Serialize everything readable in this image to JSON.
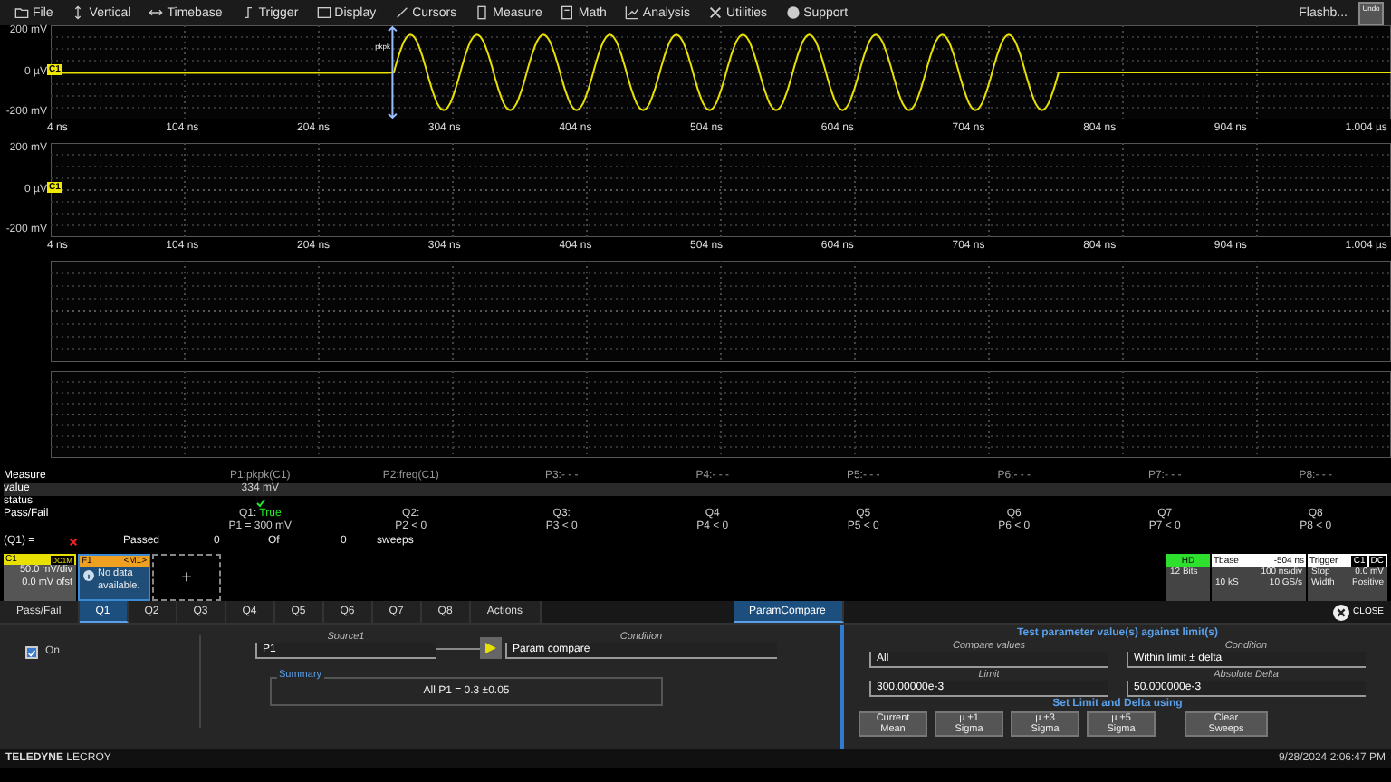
{
  "menu": {
    "items": [
      "File",
      "Vertical",
      "Timebase",
      "Trigger",
      "Display",
      "Cursors",
      "Measure",
      "Math",
      "Analysis",
      "Utilities",
      "Support"
    ],
    "right_label": "Flashb...",
    "undo": "Undo"
  },
  "grids": [
    {
      "kind": "labeled",
      "trace": true,
      "marker": "C1",
      "annotation": "pkpk",
      "y_labels": [
        "200 mV",
        "0 µV",
        "-200 mV"
      ],
      "x_labels": [
        "4 ns",
        "104 ns",
        "204 ns",
        "304 ns",
        "404 ns",
        "504 ns",
        "604 ns",
        "704 ns",
        "804 ns",
        "904 ns",
        "1.004 µs"
      ]
    },
    {
      "kind": "labeled",
      "trace": false,
      "marker": "C1",
      "y_labels": [
        "200 mV",
        "0 µV",
        "-200 mV"
      ],
      "x_labels": [
        "4 ns",
        "104 ns",
        "204 ns",
        "304 ns",
        "404 ns",
        "504 ns",
        "604 ns",
        "704 ns",
        "804 ns",
        "904 ns",
        "1.004 µs"
      ]
    },
    {
      "kind": "blank"
    },
    {
      "kind": "blank"
    }
  ],
  "measure": {
    "row_labels": [
      "Measure",
      "value",
      "status",
      "Pass/Fail"
    ],
    "params": [
      {
        "name": "P1:pkpk(C1)",
        "value": "334 mV",
        "checked": true,
        "q": "Q1:",
        "q_result": "True",
        "q_expr": "P1 = 300 mV"
      },
      {
        "name": "P2:freq(C1)",
        "checked": false,
        "q": "Q2:",
        "q_expr": "P2 < 0"
      },
      {
        "name": "P3:- - -",
        "checked": false,
        "q": "Q3:",
        "q_expr": "P3 < 0"
      },
      {
        "name": "P4:- - -",
        "checked": false,
        "q": "Q4",
        "q_expr": "P4 < 0"
      },
      {
        "name": "P5:- - -",
        "checked": false,
        "q": "Q5",
        "q_expr": "P5 < 0"
      },
      {
        "name": "P6:- - -",
        "checked": false,
        "q": "Q6",
        "q_expr": "P6 < 0"
      },
      {
        "name": "P7:- - -",
        "checked": false,
        "q": "Q7",
        "q_expr": "P7 < 0"
      },
      {
        "name": "P8:- - -",
        "checked": false,
        "q": "Q8",
        "q_expr": "P8 < 0"
      }
    ],
    "summary": {
      "label": "(Q1) =",
      "failed": true,
      "passed_label": "Passed",
      "passed": "0",
      "of_label": "Of",
      "of": "0",
      "unit": "sweeps"
    }
  },
  "descriptors": {
    "channel": {
      "name": "C1",
      "coupling": "DC1M",
      "vdiv": "50.0 mV/div",
      "offset": "0.0 mV ofst"
    },
    "function": {
      "name": "F1",
      "source": "<M1>",
      "message": "No data available."
    },
    "add": "+",
    "hd": {
      "label": "HD",
      "bits": "12 Bits"
    },
    "timebase": {
      "label": "Tbase",
      "delay": "-504 ns",
      "tdiv": "100 ns/div",
      "samples": "10 kS",
      "rate": "10 GS/s"
    },
    "trigger": {
      "label": "Trigger",
      "source": "C1",
      "coupling": "DC",
      "mode": "Stop",
      "level": "0.0 mV",
      "type": "Width",
      "slope": "Positive"
    }
  },
  "dialog": {
    "tabs": [
      {
        "label": "Pass/Fail",
        "selected": false
      },
      {
        "label": "Q1",
        "selected": true
      },
      {
        "label": "Q2",
        "selected": false
      },
      {
        "label": "Q3",
        "selected": false
      },
      {
        "label": "Q4",
        "selected": false
      },
      {
        "label": "Q5",
        "selected": false
      },
      {
        "label": "Q6",
        "selected": false
      },
      {
        "label": "Q7",
        "selected": false
      },
      {
        "label": "Q8",
        "selected": false
      },
      {
        "label": "Actions",
        "selected": false
      }
    ],
    "right_tabs": [
      {
        "label": "ParamCompare",
        "selected": true
      }
    ],
    "close": "CLOSE",
    "enable": {
      "label": "On",
      "checked": true
    },
    "source": {
      "label": "Source1",
      "value": "P1"
    },
    "condition": {
      "label": "Condition",
      "value": "Param compare"
    },
    "summary": {
      "title": "Summary",
      "text": "All P1 = 0.3 ±0.05"
    },
    "panel": {
      "heading": "Test parameter value(s) against limit(s)",
      "fields": [
        {
          "label": "Compare values",
          "value": "All"
        },
        {
          "label": "Condition",
          "value": "Within limit ± delta"
        },
        {
          "label": "Limit",
          "value": "300.00000e-3"
        },
        {
          "label": "Absolute Delta",
          "value": "50.000000e-3"
        }
      ],
      "subheading": "Set Limit and Delta using",
      "buttons": [
        "Current Mean",
        "µ ±1 Sigma",
        "µ ±3 Sigma",
        "µ ±5 Sigma",
        "Clear Sweeps"
      ]
    }
  },
  "footer": {
    "brand": "**TELEDYNE** LECROY",
    "datetime": "9/28/2024 2:06:47 PM"
  }
}
